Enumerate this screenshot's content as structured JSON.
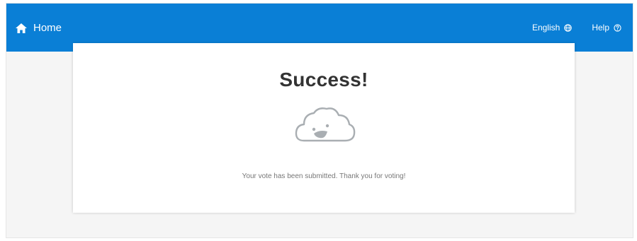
{
  "header": {
    "home_label": "Home",
    "language_label": "English",
    "help_label": "Help",
    "bg_color": "#0a7fd6"
  },
  "icons": {
    "home": "home-icon",
    "language": "globe-icon",
    "help": "question-circle-icon",
    "illustration": "smiling-cloud-icon"
  },
  "card": {
    "title": "Success!",
    "message": "Your vote has been submitted. Thank you for voting!"
  }
}
